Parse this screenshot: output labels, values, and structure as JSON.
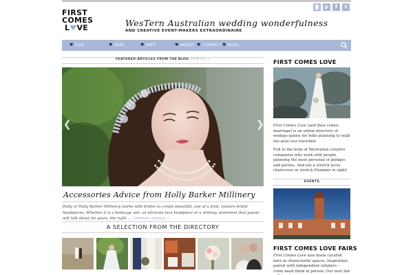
{
  "header": {
    "logo_line1": "FIRST",
    "logo_line2": "COMES",
    "logo_line3a": "L",
    "logo_heart": "♥",
    "logo_line3b": "VE",
    "tagline": "WesTern Australian wedding wonderfulness",
    "tagline_sub": "AND CREATIVE EVENT-MAKERS EXTRAORDINAIRE",
    "social_icons": [
      {
        "icon": "instagram-icon",
        "glyph": "◙"
      },
      {
        "icon": "pinterest-icon",
        "glyph": "p"
      },
      {
        "icon": "facebook-icon",
        "glyph": "f"
      },
      {
        "icon": "twitter-icon",
        "glyph": "t"
      }
    ]
  },
  "nav": {
    "heart": "♥",
    "items": [
      "LIVE",
      "FEAT",
      "WRIT",
      "ABOUT",
      "CONTACT",
      "BLOG"
    ],
    "search_icon": "search-icon"
  },
  "featured": {
    "label": "FEATURED ARTICLES FROM THE BLOG",
    "view_all": "VIEW ALL »",
    "prev_glyph": "❮",
    "next_glyph": "❯",
    "post_title": "Accessories Advice from Holly Barker Millinery",
    "excerpt": "Holly of Holly Barker Millinery works with brides to create beautiful, one of a kind, couture bridal headpieces. Whether it is a birdcage veil, an intricate lace headpiece or a striking statement that guests will talk about for years, the right …",
    "read_more": "Continue reading →"
  },
  "directory": {
    "title": "A SELECTION FROM THE DIRECTORY"
  },
  "sidebar": {
    "heading1": "FIRST COMES LOVE",
    "about_brand": "First Comes Love",
    "about_text1": " (and then comes marriage) is an online directory of wedspo galore for folks planning to walk the aisle less travelled.",
    "about_text2": "Full to the brim of Westralian creative companies who work with people planning the most personal of pledges and parties. And not a stretch lycra chaircover or stretch Hummer in sight!",
    "events_label": "EVENTS",
    "heading2": "FIRST COMES LOVE FAIRS",
    "fairs_brand": "First Comes Love",
    "fairs_text": " also hosts curated fairs in characterful spaces. Inspiration paired with independent retailers – come meet them in person. Our next fair will be at"
  },
  "colors": {
    "nav_bg": "#a9b8d6",
    "accent": "#8fa6cf",
    "heart_blue": "#9fb3d8"
  }
}
